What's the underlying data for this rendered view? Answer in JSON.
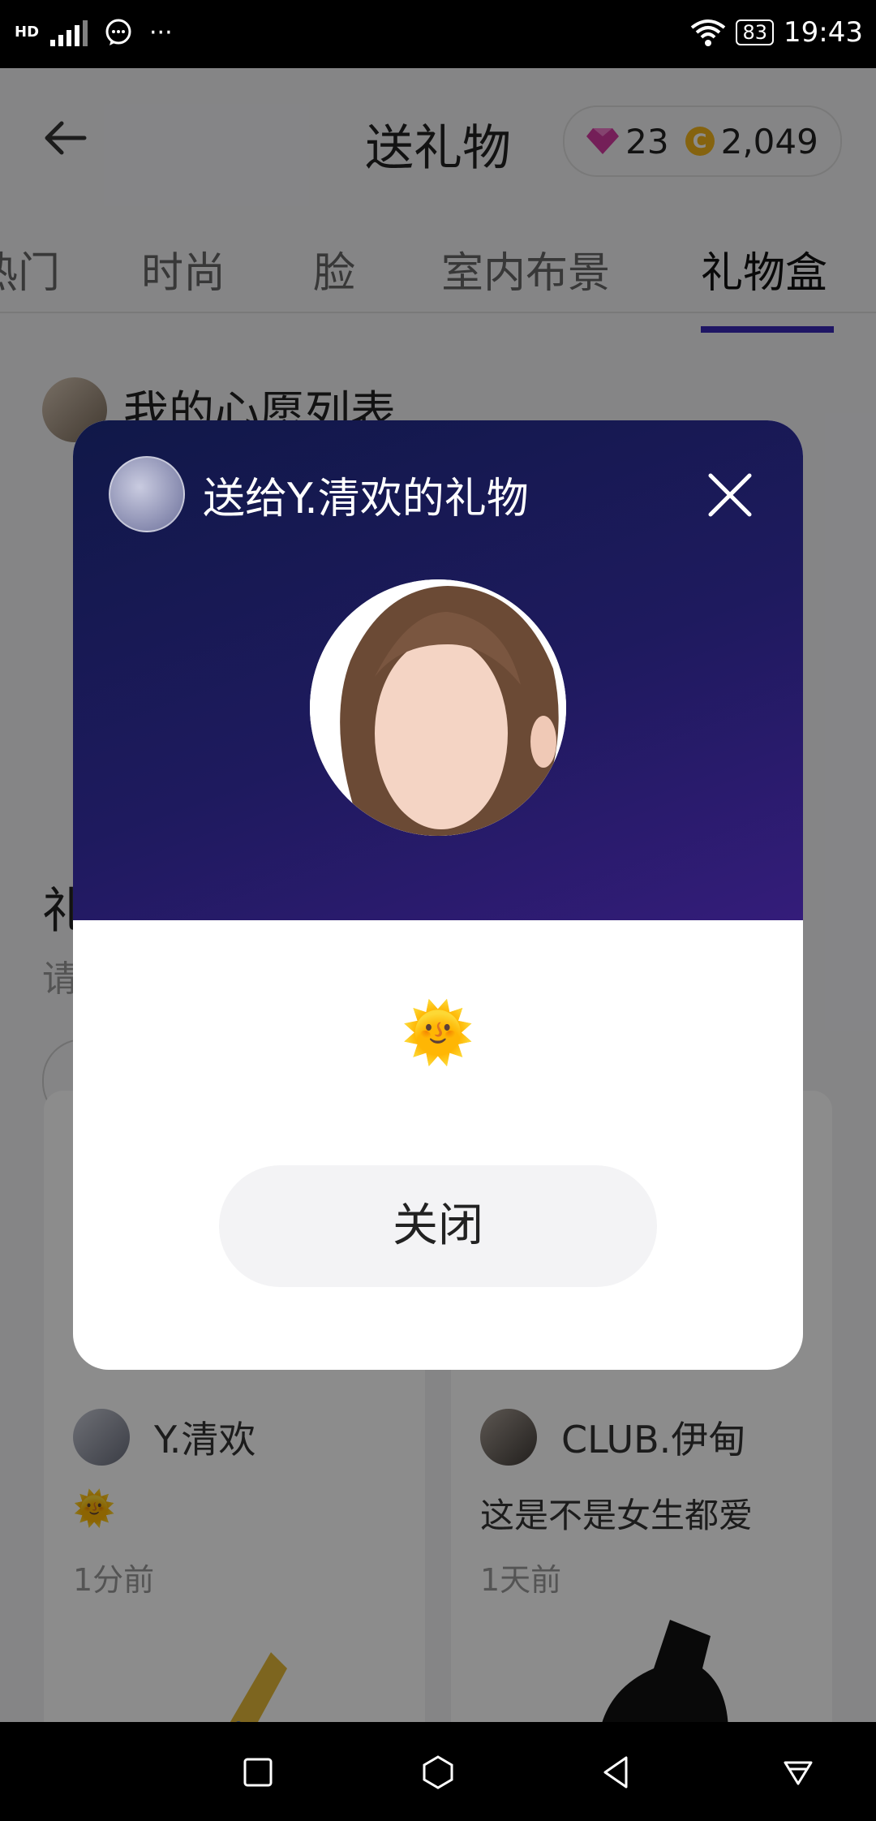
{
  "status_bar": {
    "network": "HD",
    "more": "···",
    "battery": "83",
    "time": "19:43"
  },
  "header": {
    "title": "送礼物",
    "diamonds": "23",
    "coins": "2,049",
    "coin_letter": "C"
  },
  "tabs": [
    "热门",
    "时尚",
    "脸",
    "室内布景",
    "礼物盒"
  ],
  "wishlist": {
    "label": "我的心愿列表"
  },
  "left_peek": {
    "char1": "礼",
    "char2": "请"
  },
  "cards": [
    {
      "user": "Y.清欢",
      "desc": "🌞",
      "time": "1分前"
    },
    {
      "user": "CLUB.伊甸",
      "desc": "这是不是女生都爱",
      "time": "1天前"
    }
  ],
  "modal": {
    "title": "送给Y.清欢的礼物",
    "message": "🌞",
    "close_label": "关闭"
  },
  "colors": {
    "accent": "#3a28b6",
    "modal_top": "#101848",
    "modal_bottom": "#341c7a",
    "coin": "#f3b51d",
    "diamond": "#d43aa0"
  }
}
